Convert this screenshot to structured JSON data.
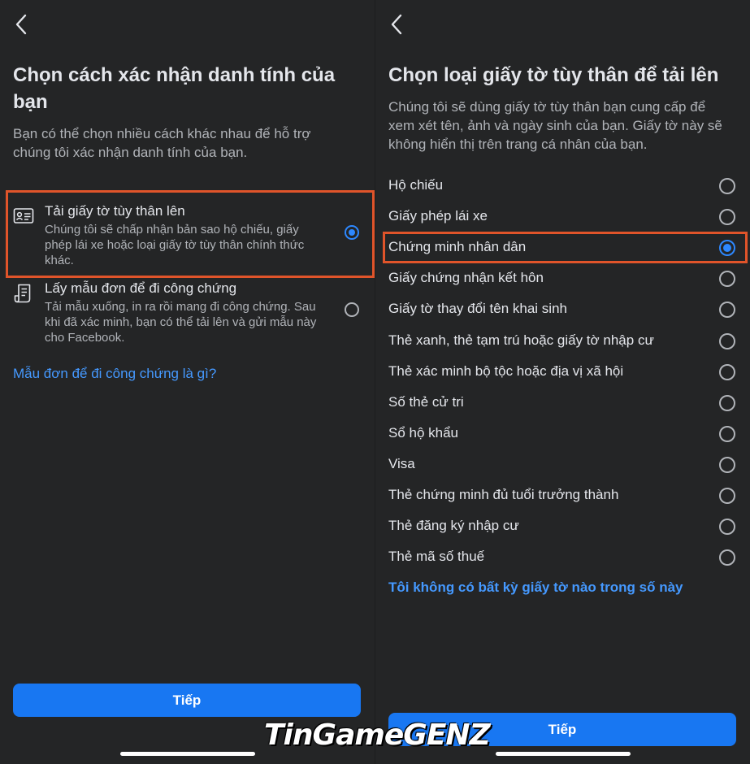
{
  "left": {
    "title_line1": "Chọn cách xác nhận danh tính của",
    "title_line2": "bạn",
    "description_line1": "Bạn có thể chọn nhiều cách khác nhau để hỗ trợ",
    "description_line2": "chúng tôi xác nhận danh tính của bạn.",
    "options": [
      {
        "icon": "id-card-icon",
        "title": "Tải giấy tờ tùy thân lên",
        "sub1": "Chúng tôi sẽ chấp nhận bản sao hộ chiếu, giấy",
        "sub2": "phép lái xe hoặc loại giấy tờ tùy thân chính thức",
        "sub3": "khác.",
        "selected": true
      },
      {
        "icon": "document-form-icon",
        "title": "Lấy mẫu đơn để đi công chứng",
        "sub1": "Tải mẫu xuống, in ra rồi mang đi công chứng. Sau",
        "sub2": "khi đã xác minh, bạn có thể tải lên và gửi mẫu này",
        "sub3": "cho Facebook.",
        "selected": false
      }
    ],
    "link": "Mẫu đơn để đi công chứng là gì?",
    "button": "Tiếp"
  },
  "right": {
    "title": "Chọn loại giấy tờ tùy thân để tải lên",
    "description_line1": "Chúng tôi sẽ dùng giấy tờ tùy thân bạn cung cấp để",
    "description_line2": "xem xét tên, ảnh và ngày sinh của bạn. Giấy tờ này sẽ",
    "description_line3": "không hiển thị trên trang cá nhân của bạn.",
    "items": [
      {
        "label": "Hộ chiếu",
        "selected": false
      },
      {
        "label": "Giấy phép lái xe",
        "selected": false
      },
      {
        "label": "Chứng minh nhân dân",
        "selected": true
      },
      {
        "label": "Giấy chứng nhận kết hôn",
        "selected": false
      },
      {
        "label": "Giấy tờ thay đổi tên khai sinh",
        "selected": false
      },
      {
        "label": "Thẻ xanh, thẻ tạm trú hoặc giấy tờ nhập cư",
        "selected": false
      },
      {
        "label": "Thẻ xác minh bộ tộc hoặc địa vị xã hội",
        "selected": false
      },
      {
        "label": "Số thẻ cử tri",
        "selected": false
      },
      {
        "label": "Sổ hộ khẩu",
        "selected": false
      },
      {
        "label": "Visa",
        "selected": false
      },
      {
        "label": "Thẻ chứng minh đủ tuổi trưởng thành",
        "selected": false
      },
      {
        "label": "Thẻ đăng ký nhập cư",
        "selected": false
      },
      {
        "label": "Thẻ mã số thuế",
        "selected": false
      }
    ],
    "link": "Tôi không có bất kỳ giấy tờ nào trong số này",
    "button": "Tiếp"
  },
  "watermark": "TinGameGENZ",
  "colors": {
    "background": "#242526",
    "accent": "#1877f2",
    "link": "#4599ff",
    "highlight": "#e0542a"
  }
}
